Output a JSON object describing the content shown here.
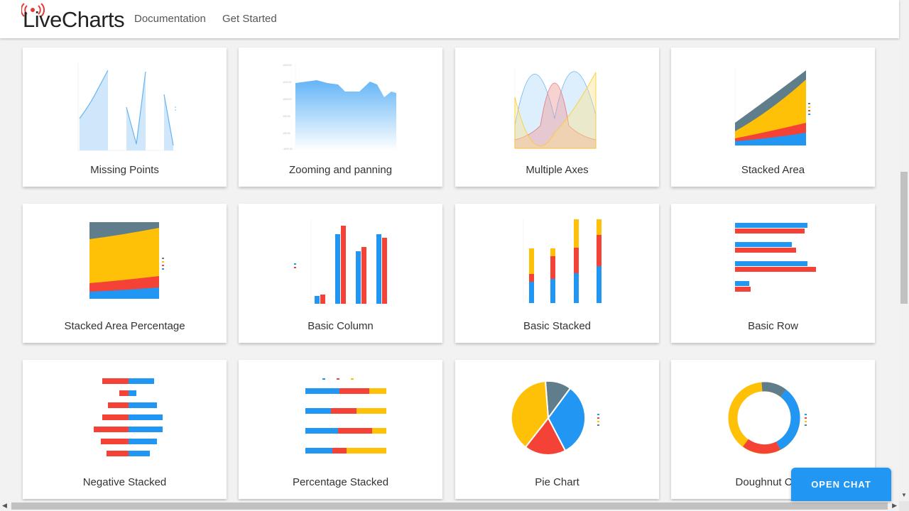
{
  "header": {
    "brand": "LiveCharts",
    "nav": [
      "Documentation",
      "Get Started"
    ]
  },
  "colors": {
    "blue": "#2196f3",
    "red": "#f44336",
    "yellow": "#ffc107",
    "slate": "#607d8b"
  },
  "cards": [
    {
      "label": "Missing Points"
    },
    {
      "label": "Zooming and panning"
    },
    {
      "label": "Multiple Axes"
    },
    {
      "label": "Stacked Area"
    },
    {
      "label": "Stacked Area Percentage"
    },
    {
      "label": "Basic Column"
    },
    {
      "label": "Basic Stacked"
    },
    {
      "label": "Basic Row"
    },
    {
      "label": "Negative Stacked"
    },
    {
      "label": "Percentage Stacked"
    },
    {
      "label": "Pie Chart"
    },
    {
      "label": "Doughnut Chart"
    }
  ],
  "chat": {
    "label": "OPEN CHAT"
  }
}
